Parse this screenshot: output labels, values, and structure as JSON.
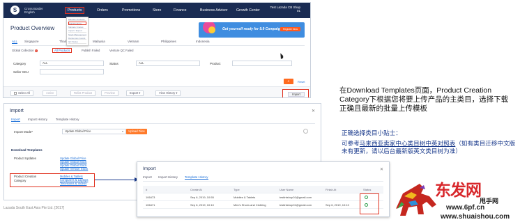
{
  "top": {
    "logo": "S",
    "region": [
      "Cross Border",
      "English"
    ],
    "nav": [
      "Products",
      "Orders",
      "Promotions",
      "Store",
      "Finance",
      "Business Advisor",
      "Growth Center"
    ],
    "shop": [
      "Test Lazada CB Shop",
      "01"
    ],
    "dropdown": [
      "Manage Products",
      "Add Products",
      "Manage Images",
      "Import / Export",
      "Stock Management",
      "Dangerous Goods",
      "QC Status",
      "Product Decoration",
      "Shipping Prices"
    ],
    "page_title": "Product Overview",
    "banner": {
      "text": "Get yourself ready for 9.9 Campaign",
      "button": "Register Now"
    },
    "country_tabs": [
      "ALL",
      "Singapore",
      "Thailand",
      "Malaysia",
      "Vietnam",
      "Philippines",
      "Indonesia"
    ],
    "sub_tabs": {
      "global": "Global Collection",
      "global_badge": "6",
      "all": "All Products",
      "failed": "Publish Failed",
      "qc": "Venture QC Failed"
    },
    "filters": {
      "category_label": "Category",
      "category_value": "ALL",
      "status_label": "Status",
      "status_value": "ALL",
      "product_label": "Product",
      "product_value": "",
      "seller_sku_label": "Seller SKU",
      "seller_sku_value": "",
      "search_icon": "search-icon",
      "reset": "Reset"
    },
    "toolbar": {
      "select_all": "Select All",
      "active": "Active",
      "relist": "Relist Product",
      "preview": "Preview",
      "export": "Export",
      "view_history": "View History",
      "import": "Import"
    }
  },
  "import": {
    "title": "Import",
    "tabs": [
      "Import",
      "Import History",
      "Template History"
    ],
    "mode_label": "Import Mode*",
    "mode_value": "Update Global Price",
    "upload": "Upload Files",
    "download_heading": "Download Templates",
    "rows": [
      {
        "label": "Product Updates",
        "links": [
          "Update Global Price",
          "Update Global Stock",
          "Update Global Stock",
          "Update Version Stock"
        ]
      },
      {
        "label": "Product Creation Category",
        "links": [
          "Mobiles & Tablets",
          "Computers & Laptops",
          "Televisions & Videos"
        ]
      }
    ]
  },
  "history": {
    "title": "Import",
    "tabs": [
      "Import",
      "Import History",
      "Template History"
    ],
    "columns": [
      "#",
      "Create At",
      "Type",
      "User Name",
      "Finish At",
      "Status"
    ],
    "rows": [
      {
        "id": "106473",
        "created": "Sep 6, 2019, 10:55",
        "type": "Mobiles & Tablets",
        "user": "testintshop01@gmail.com",
        "finish": "",
        "status": "ok"
      },
      {
        "id": "106471",
        "created": "Sep 6, 2019, 10:10",
        "type": "Men's Shoes and Clothing",
        "user": "testintshop01@gmail.com",
        "finish": "Sep 6, 2019, 10:10",
        "status": "ok"
      }
    ]
  },
  "annotations": {
    "note1": "在Download Templates页面，Product Creation Category下根据您将要上传产品的主类目，选择下载正确且最新的批量上传模板",
    "note2_title": "正确选择类目小贴士：",
    "note2_prefix": "可参考",
    "note2_link": "马来西亚卖家中心类目树中英对照表",
    "note2_suffix": "（如有类目迁移中文版未有更新，请以后台最新版英文类目树为准）",
    "copyright": "Lazada South East Asia Pte Ltd. [2017]"
  },
  "watermark": {
    "brand": "东发网",
    "sub": "甩手网",
    "url1": "www.6pf.cn",
    "url2": "www.shuaishou.com"
  },
  "colors": {
    "nav_bg": "#1a2c53",
    "accent": "#ff6a1f",
    "highlight": "#e0301e",
    "link": "#1a6ed8",
    "annotation": "#1a3a8c"
  }
}
